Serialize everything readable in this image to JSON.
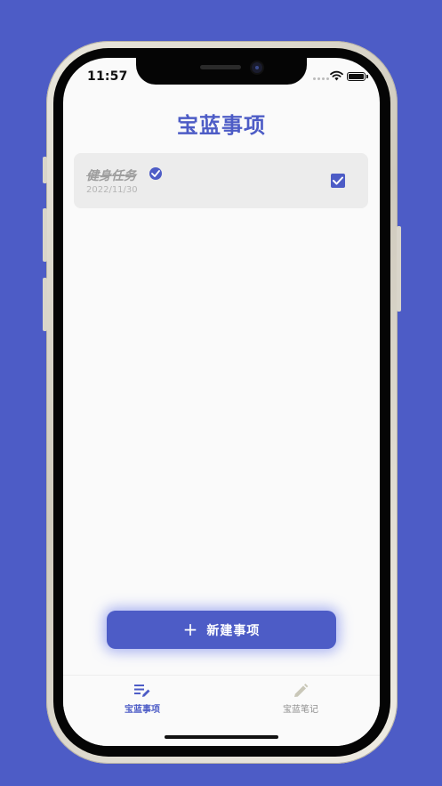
{
  "status_bar": {
    "time": "11:57",
    "icons": [
      "signal-dots-icon",
      "wifi-icon",
      "battery-icon"
    ]
  },
  "header": {
    "title": "宝蓝事项"
  },
  "todos": [
    {
      "title": "健身任务",
      "date": "2022/11/30",
      "completed": true,
      "status_icon": "check-circle-icon",
      "checkbox_icon": "checkbox-checked-icon"
    }
  ],
  "actions": {
    "new_button_icon": "plus-icon",
    "new_button_glyph": "+",
    "new_button_label": "新建事项"
  },
  "bottom_nav": {
    "items": [
      {
        "label": "宝蓝事项",
        "icon": "list-edit-icon",
        "active": true
      },
      {
        "label": "宝蓝笔记",
        "icon": "pencil-icon",
        "active": false
      }
    ]
  },
  "colors": {
    "brand": "#4d5cc6",
    "screen_background": "#fafafa",
    "card_background": "#ececec",
    "muted_text": "#9e9e9e",
    "inactive_nav": "#8f8f8f"
  }
}
